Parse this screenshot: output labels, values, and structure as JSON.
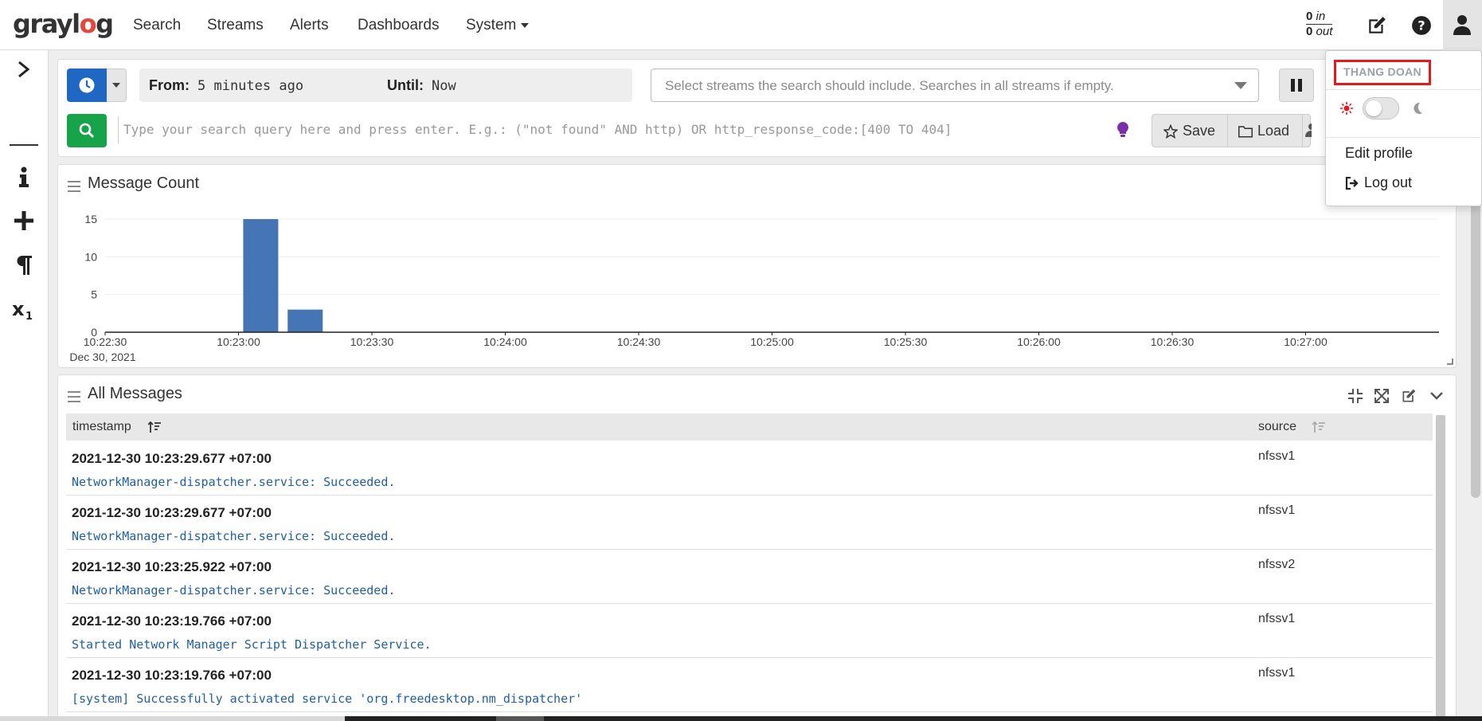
{
  "nav": {
    "logo": "graylog",
    "items": [
      "Search",
      "Streams",
      "Alerts",
      "Dashboards",
      "System"
    ],
    "throughput_in_value": "0",
    "throughput_in_label": "in",
    "throughput_out_value": "0",
    "throughput_out_label": "out"
  },
  "search": {
    "from_label": "From:",
    "from_value": "5 minutes ago",
    "until_label": "Until:",
    "until_value": "Now",
    "streams_placeholder": "Select streams the search should include. Searches in all streams if empty.",
    "query_placeholder": "Type your search query here and press enter. E.g.: (\"not found\" AND http) OR http_response_code:[400 TO 404]",
    "save_label": "Save",
    "load_label": "Load"
  },
  "chart_panel": {
    "title": "Message Count"
  },
  "chart_data": {
    "type": "bar",
    "title": "Message Count",
    "x": [
      "10:23:05",
      "10:23:15"
    ],
    "values": [
      15,
      3
    ],
    "x_range": [
      "10:22:30",
      "10:27:30"
    ],
    "x_ticks": [
      "10:22:30",
      "10:23:00",
      "10:23:30",
      "10:24:00",
      "10:24:30",
      "10:25:00",
      "10:25:30",
      "10:26:00",
      "10:26:30",
      "10:27:00"
    ],
    "x_date_label": "Dec 30, 2021",
    "y_ticks": [
      "0",
      "5",
      "10",
      "15"
    ],
    "ylim": [
      0,
      15
    ],
    "bar_color": "#4575b4",
    "grid": true
  },
  "messages_panel": {
    "title": "All Messages",
    "columns": [
      "timestamp",
      "source"
    ],
    "rows": [
      {
        "timestamp": "2021-12-30 10:23:29.677 +07:00",
        "message": "NetworkManager-dispatcher.service: Succeeded.",
        "source": "nfssv1"
      },
      {
        "timestamp": "2021-12-30 10:23:29.677 +07:00",
        "message": "NetworkManager-dispatcher.service: Succeeded.",
        "source": "nfssv1"
      },
      {
        "timestamp": "2021-12-30 10:23:25.922 +07:00",
        "message": "NetworkManager-dispatcher.service: Succeeded.",
        "source": "nfssv2"
      },
      {
        "timestamp": "2021-12-30 10:23:19.766 +07:00",
        "message": "Started Network Manager Script Dispatcher Service.",
        "source": "nfssv1"
      },
      {
        "timestamp": "2021-12-30 10:23:19.766 +07:00",
        "message": "[system] Successfully activated service 'org.freedesktop.nm_dispatcher'",
        "source": "nfssv1"
      }
    ]
  },
  "user_menu": {
    "username": "THANG DOAN",
    "edit_profile": "Edit profile",
    "logout": "Log out"
  },
  "colors": {
    "primary_button": "#1f67c3",
    "search_button": "#16a34a",
    "highlight_border": "#e6191e",
    "message_text": "#1f5fa3"
  }
}
